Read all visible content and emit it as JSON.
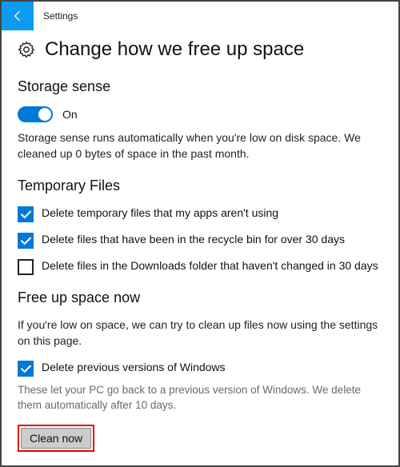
{
  "titlebar": {
    "title": "Settings"
  },
  "header": {
    "title": "Change how we free up space"
  },
  "storage_sense": {
    "heading": "Storage sense",
    "toggle_state": "On",
    "description": "Storage sense runs automatically when you're low on disk space. We cleaned up 0 bytes of space in the past month."
  },
  "temp_files": {
    "heading": "Temporary Files",
    "options": [
      {
        "label": "Delete temporary files that my apps aren't using",
        "checked": true
      },
      {
        "label": "Delete files that have been in the recycle bin for over 30 days",
        "checked": true
      },
      {
        "label": "Delete files in the Downloads folder that haven't changed in 30 days",
        "checked": false
      }
    ]
  },
  "free_up": {
    "heading": "Free up space now",
    "description": "If you're low on space, we can try to clean up files now using the settings on this page.",
    "prev_versions": {
      "label": "Delete previous versions of Windows",
      "checked": true
    },
    "note": "These let your PC go back to a previous version of Windows. We delete them automatically after 10 days.",
    "button": "Clean now"
  }
}
